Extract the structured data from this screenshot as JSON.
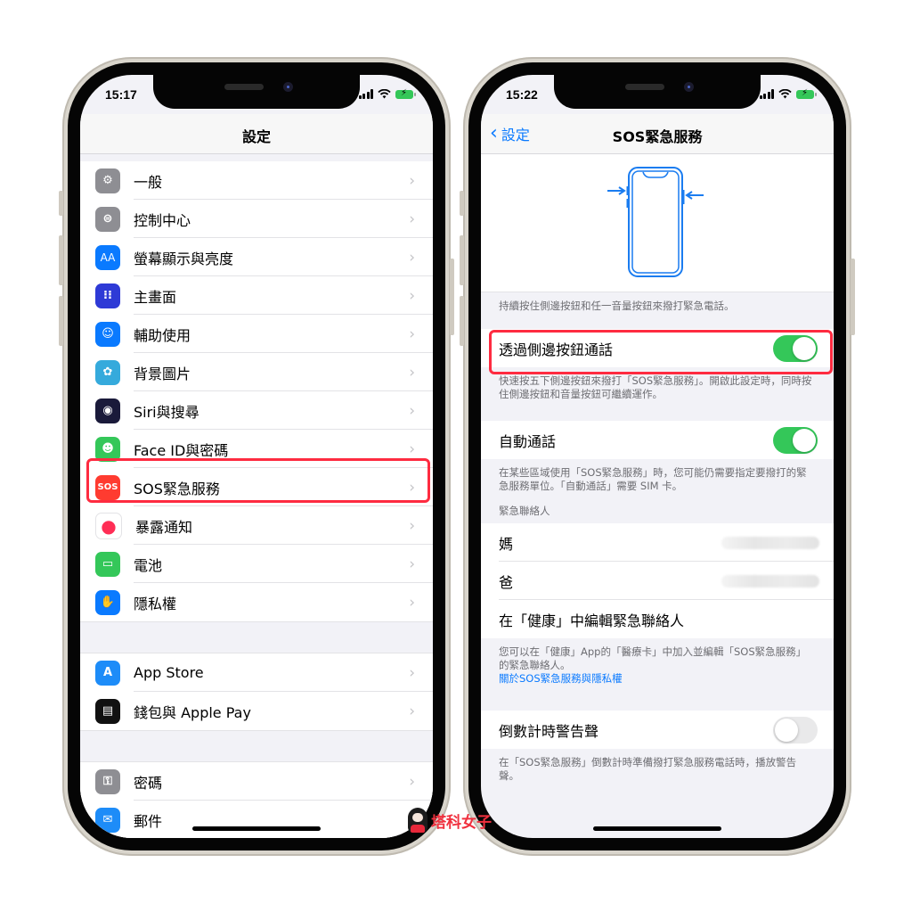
{
  "left_phone": {
    "status_time": "15:17",
    "nav_title": "設定",
    "groups": [
      [
        {
          "label": "一般",
          "icon": "gear-icon",
          "color": "#8e8e93"
        },
        {
          "label": "控制中心",
          "icon": "switches-icon",
          "color": "#8e8e93"
        },
        {
          "label": "螢幕顯示與亮度",
          "icon": "text-size-icon",
          "color": "#0a7aff"
        },
        {
          "label": "主畫面",
          "icon": "home-screen-icon",
          "color": "#2e3ad6"
        },
        {
          "label": "輔助使用",
          "icon": "accessibility-icon",
          "color": "#0a7aff"
        },
        {
          "label": "背景圖片",
          "icon": "wallpaper-flower-icon",
          "color": "#35aadc"
        },
        {
          "label": "Siri與搜尋",
          "icon": "siri-icon",
          "color": "#1a1a3a"
        },
        {
          "label": "Face ID與密碼",
          "icon": "face-id-icon",
          "color": "#34c759"
        },
        {
          "label": "SOS緊急服務",
          "icon": "sos-icon",
          "color": "#ff3b30",
          "highlighted": true
        },
        {
          "label": "暴露通知",
          "icon": "exposure-notification-icon",
          "color": "#ffffff"
        },
        {
          "label": "電池",
          "icon": "battery-icon",
          "color": "#34c759"
        },
        {
          "label": "隱私權",
          "icon": "hand-icon",
          "color": "#0a7aff"
        }
      ],
      [
        {
          "label": "App Store",
          "icon": "app-store-icon",
          "color": "#1d8cf8"
        },
        {
          "label": "錢包與 Apple Pay",
          "icon": "wallet-icon",
          "color": "#111111"
        }
      ],
      [
        {
          "label": "密碼",
          "icon": "key-icon",
          "color": "#8e8e93"
        },
        {
          "label": "郵件",
          "icon": "mail-icon",
          "color": "#1d8cf8"
        }
      ]
    ],
    "sos_icon_text": "SOS",
    "text_size_icon_text": "AA"
  },
  "right_phone": {
    "status_time": "15:22",
    "back_label": "設定",
    "nav_title": "SOS緊急服務",
    "illustration_caption": "持續按住側邊按鈕和任一音量按鈕來撥打緊急電話。",
    "call_with_side_button": {
      "label": "透過側邊按鈕通話",
      "on": true,
      "footnote": "快速按五下側邊按鈕來撥打「SOS緊急服務」。開啟此設定時，同時按住側邊按鈕和音量按鈕可繼續運作。"
    },
    "auto_call": {
      "label": "自動通話",
      "on": true,
      "footnote": "在某些區域使用「SOS緊急服務」時，您可能仍需要指定要撥打的緊急服務單位。「自動通話」需要 SIM 卡。"
    },
    "contacts_header": "緊急聯絡人",
    "contacts": [
      {
        "name": "媽",
        "number_hidden": true
      },
      {
        "name": "爸",
        "number_hidden": true
      }
    ],
    "edit_contacts_link": "在「健康」中編輯緊急聯絡人",
    "health_footnote": "您可以在「健康」App的「醫療卡」中加入並編輯「SOS緊急服務」的緊急聯絡人。",
    "privacy_link": "關於SOS緊急服務與隱私權",
    "countdown_sound": {
      "label": "倒數計時警告聲",
      "on": false,
      "footnote": "在「SOS緊急服務」倒數計時準備撥打緊急服務電話時，播放警告聲。"
    }
  },
  "colors": {
    "accent_blue": "#0a7aff",
    "toggle_green": "#34c759",
    "highlight_red": "#fe2b40"
  },
  "watermark": {
    "text": "塔科女子"
  }
}
